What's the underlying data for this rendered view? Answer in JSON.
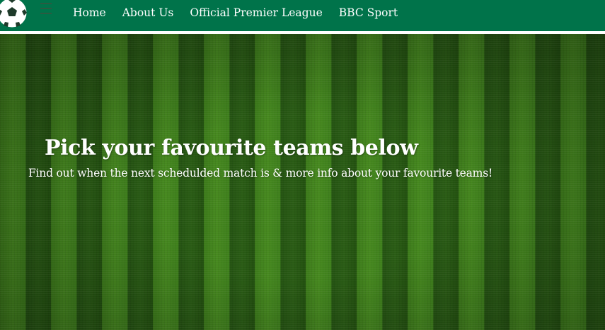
{
  "nav": {
    "logo_icon": "football-icon",
    "menu_icon": "hamburger-menu-icon",
    "links": [
      {
        "label": "Home"
      },
      {
        "label": "About Us"
      },
      {
        "label": "Official Premier League"
      },
      {
        "label": "BBC Sport"
      }
    ]
  },
  "hero": {
    "background": "striped-grass-pitch",
    "title": "Pick your favourite teams below",
    "subtitle": "Find out when the next schedulded match is & more info about your favourite teams!"
  },
  "colors": {
    "navbar": "#00734a",
    "nav_border": "#ffffff",
    "text": "#ffffff",
    "grass_light": "#46891f",
    "grass_dark": "#245312"
  }
}
